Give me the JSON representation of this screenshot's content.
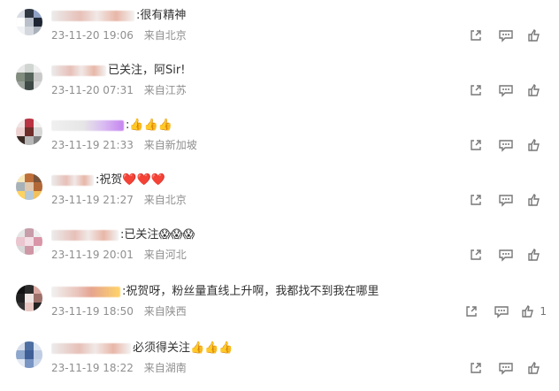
{
  "comments": [
    {
      "text": ":很有精神",
      "time": "23-11-20 19:06",
      "location": "来自北京",
      "like_count": "",
      "avatar_colors": [
        "#d8dce4",
        "#303844",
        "#91a3c5",
        "#ffffff",
        "#b9c0ca",
        "#1f2633",
        "#f0f2f5",
        "#d4d8de",
        "#a9b1ba"
      ]
    },
    {
      "text": "已关注，阿Sir!",
      "time": "23-11-20 07:31",
      "location": "来自江苏",
      "like_count": "",
      "avatar_colors": [
        "#e8e8e8",
        "#d0d5d1",
        "#f0f0f0",
        "#828c7f",
        "#56645b",
        "#c9c9c9",
        "#9aa19b",
        "#3f4945",
        "#d9d9d9"
      ]
    },
    {
      "text": ":👍👍👍",
      "time": "23-11-19 21:33",
      "location": "来自新加坡",
      "like_count": "",
      "avatar_colors": [
        "#f0e4e4",
        "#b93342",
        "#f3efef",
        "#eed2d2",
        "#6f2e2a",
        "#d7d7d7",
        "#3a2a25",
        "#b7b7b7",
        "#7e7e7e"
      ]
    },
    {
      "text": ":祝贺❤️❤️❤️",
      "time": "23-11-19 21:27",
      "location": "来自北京",
      "like_count": "",
      "avatar_colors": [
        "#f8e9bb",
        "#bf6f39",
        "#79543b",
        "#a7b1b8",
        "#dfc8ad",
        "#b26836",
        "#ffd35f",
        "#b4c8d8",
        "#f2c15e"
      ]
    },
    {
      "text": ":已关注😱😱😱",
      "time": "23-11-19 20:01",
      "location": "来自河北",
      "like_count": "",
      "avatar_colors": [
        "#e5e5e5",
        "#c79daa",
        "#efefef",
        "#ebc5cf",
        "#f2dee4",
        "#d996a8",
        "#d8d8d8",
        "#cf97a6",
        "#f4f4f4"
      ]
    },
    {
      "text": ":祝贺呀，粉丝量直线上升啊，我都找不到我在哪里",
      "time": "23-11-19 18:50",
      "location": "来自陕西",
      "like_count": "1",
      "avatar_colors": [
        "#121212",
        "#2b2b2b",
        "#d8a7a0",
        "#212121",
        "#efe6e3",
        "#9d706a",
        "#333333",
        "#e8c7c2",
        "#222222"
      ]
    },
    {
      "text": "必须得关注👍👍👍",
      "time": "23-11-19 18:22",
      "location": "来自湖南",
      "like_count": "",
      "avatar_colors": [
        "#d6deeb",
        "#4d6fa2",
        "#dce5f2",
        "#8ea7cc",
        "#3f5f97",
        "#bfcde4",
        "#e4eaf4",
        "#7895c4",
        "#cad7ea"
      ]
    }
  ]
}
